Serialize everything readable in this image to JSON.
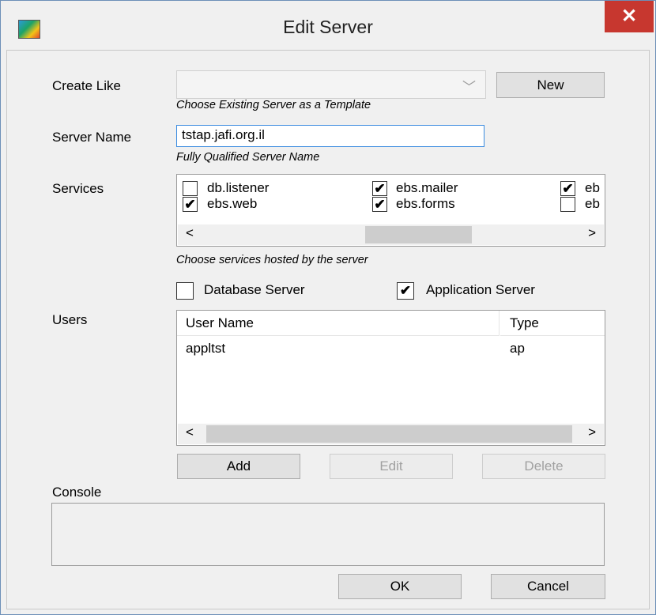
{
  "window": {
    "title": "Edit Server",
    "close_glyph": "✕"
  },
  "create_like": {
    "label": "Create Like",
    "value": "",
    "hint": "Choose Existing Server as a Template",
    "new_button": "New"
  },
  "server_name": {
    "label": "Server Name",
    "value": "tstap.jafi.org.il",
    "hint": "Fully Qualified Server Name"
  },
  "services": {
    "label": "Services",
    "hint": "Choose services hosted by the server",
    "items": [
      {
        "label": "db.listener",
        "checked": false
      },
      {
        "label": "ebs.mailer",
        "checked": true
      },
      {
        "label": "eb",
        "checked": true
      },
      {
        "label": "ebs.web",
        "checked": true
      },
      {
        "label": "ebs.forms",
        "checked": true
      },
      {
        "label": "eb",
        "checked": false
      }
    ]
  },
  "server_type": {
    "database_server": {
      "label": "Database Server",
      "checked": false
    },
    "application_server": {
      "label": "Application Server",
      "checked": true
    }
  },
  "users": {
    "label": "Users",
    "columns": [
      "User Name",
      "Type"
    ],
    "rows": [
      [
        "appltst",
        "ap"
      ]
    ],
    "add_button": "Add",
    "edit_button": "Edit",
    "delete_button": "Delete"
  },
  "console": {
    "label": "Console"
  },
  "footer": {
    "ok_button": "OK",
    "cancel_button": "Cancel"
  },
  "scroll": {
    "left_glyph": "<",
    "right_glyph": ">"
  },
  "icons": {
    "check": "✔",
    "chevron": "﹀"
  }
}
